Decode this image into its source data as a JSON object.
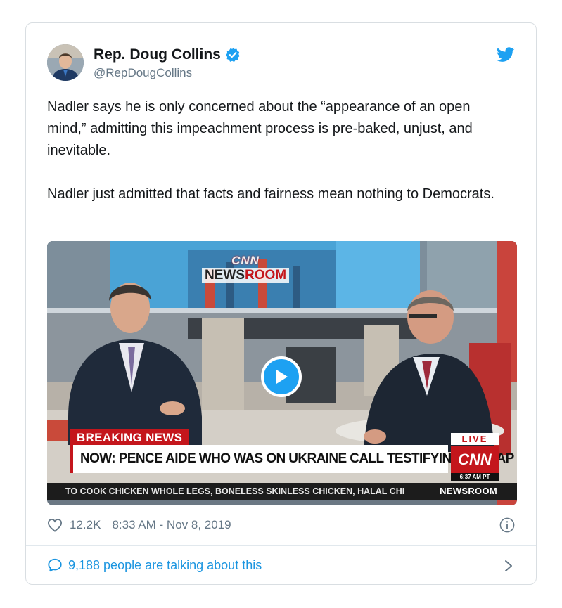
{
  "tweet": {
    "author": {
      "name": "Rep. Doug Collins",
      "handle": "@RepDougCollins",
      "verified": true
    },
    "paragraphs": [
      "Nadler says he is only concerned about the “appearance of an open mind,” admitting this impeachment process is pre-baked, unjust, and inevitable.",
      "Nadler just admitted that facts and fairness mean nothing to Democrats."
    ],
    "video": {
      "logo_top": "CNN",
      "logo_bottom_a": "NEWS",
      "logo_bottom_b": "ROOM",
      "breaking_label": "BREAKING NEWS",
      "headline": "NOW: PENCE AIDE WHO WAS ON UKRAINE CALL TESTIFYING ON CAP HILL",
      "live_label": "LIVE",
      "network": "CNN",
      "time": "6:37 AM PT",
      "ticker": "TO COOK CHICKEN WHOLE LEGS, BONELESS SKINLESS CHICKEN, HALAL CHI",
      "ticker_brand": "NEWSROOM"
    },
    "likes": "12.2K",
    "timestamp": "8:33 AM - Nov 8, 2019",
    "talking": "9,188 people are talking about this"
  },
  "colors": {
    "accent_blue": "#1da1f2",
    "link_blue": "#1b95e0",
    "muted_gray": "#657786",
    "cnn_red": "#c4161c"
  },
  "icons": {
    "verified": "verified-badge-icon",
    "brand": "twitter-bird-icon",
    "like": "heart-icon",
    "info": "info-icon",
    "talk": "speech-bubble-icon",
    "more": "chevron-right-icon",
    "play": "play-icon"
  }
}
